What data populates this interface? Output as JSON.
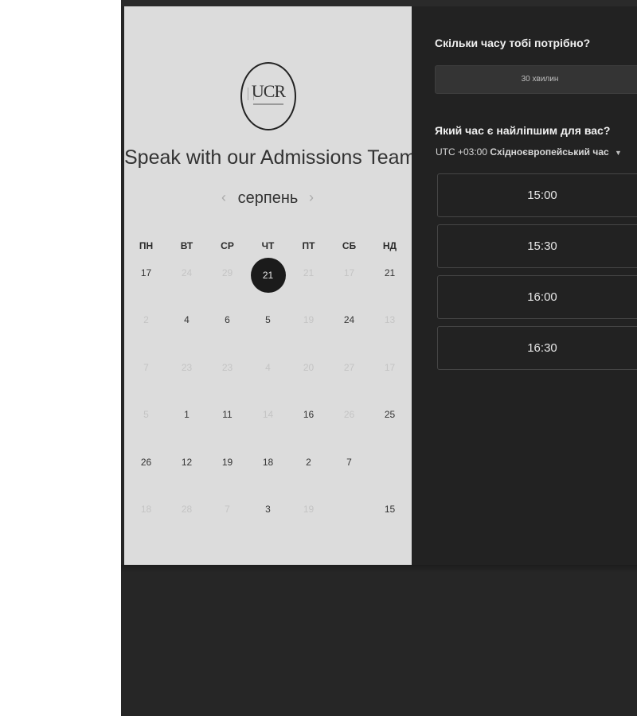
{
  "booking": {
    "logo_text": "UCR",
    "title": "Speak with our Admissions Team"
  },
  "calendar": {
    "month": "серпень",
    "prev_icon": "chevron-left-icon",
    "next_icon": "chevron-right-icon",
    "prev_glyph": "‹",
    "next_glyph": "›",
    "weekdays": [
      "ПН",
      "ВТ",
      "СР",
      "ЧТ",
      "ПТ",
      "СБ",
      "НД"
    ],
    "days": [
      {
        "label": "17",
        "state": "normal"
      },
      {
        "label": "24",
        "state": "faded"
      },
      {
        "label": "29",
        "state": "faded"
      },
      {
        "label": "21",
        "state": "selected"
      },
      {
        "label": "21",
        "state": "faded"
      },
      {
        "label": "17",
        "state": "faded"
      },
      {
        "label": "21",
        "state": "normal"
      },
      {
        "label": "2",
        "state": "faded"
      },
      {
        "label": "4",
        "state": "normal"
      },
      {
        "label": "6",
        "state": "normal"
      },
      {
        "label": "5",
        "state": "normal"
      },
      {
        "label": "19",
        "state": "faded"
      },
      {
        "label": "24",
        "state": "normal"
      },
      {
        "label": "13",
        "state": "faded"
      },
      {
        "label": "7",
        "state": "faded"
      },
      {
        "label": "23",
        "state": "faded"
      },
      {
        "label": "23",
        "state": "faded"
      },
      {
        "label": "4",
        "state": "faded"
      },
      {
        "label": "20",
        "state": "faded"
      },
      {
        "label": "27",
        "state": "faded"
      },
      {
        "label": "17",
        "state": "faded"
      },
      {
        "label": "5",
        "state": "faded"
      },
      {
        "label": "1",
        "state": "normal"
      },
      {
        "label": "11",
        "state": "normal"
      },
      {
        "label": "14",
        "state": "faded"
      },
      {
        "label": "16",
        "state": "normal"
      },
      {
        "label": "26",
        "state": "faded"
      },
      {
        "label": "25",
        "state": "normal"
      },
      {
        "label": "26",
        "state": "normal"
      },
      {
        "label": "12",
        "state": "normal"
      },
      {
        "label": "19",
        "state": "normal"
      },
      {
        "label": "18",
        "state": "normal"
      },
      {
        "label": "2",
        "state": "normal"
      },
      {
        "label": "7",
        "state": "normal"
      },
      {
        "label": "",
        "state": "faded"
      },
      {
        "label": "18",
        "state": "faded"
      },
      {
        "label": "28",
        "state": "faded"
      },
      {
        "label": "7",
        "state": "faded"
      },
      {
        "label": "3",
        "state": "normal"
      },
      {
        "label": "19",
        "state": "faded"
      },
      {
        "label": "",
        "state": "faded"
      },
      {
        "label": "15",
        "state": "normal"
      }
    ]
  },
  "scheduler": {
    "duration_heading": "Скільки часу тобі потрібно?",
    "duration_value": "30 хвилин",
    "time_heading": "Який час є найліпшим для вас?",
    "timezone_offset": "UTC +03:00",
    "timezone_name": "Східноєвропейський час",
    "timezone_caret": "▼",
    "slots": [
      "15:00",
      "15:30",
      "16:00",
      "16:30"
    ]
  }
}
